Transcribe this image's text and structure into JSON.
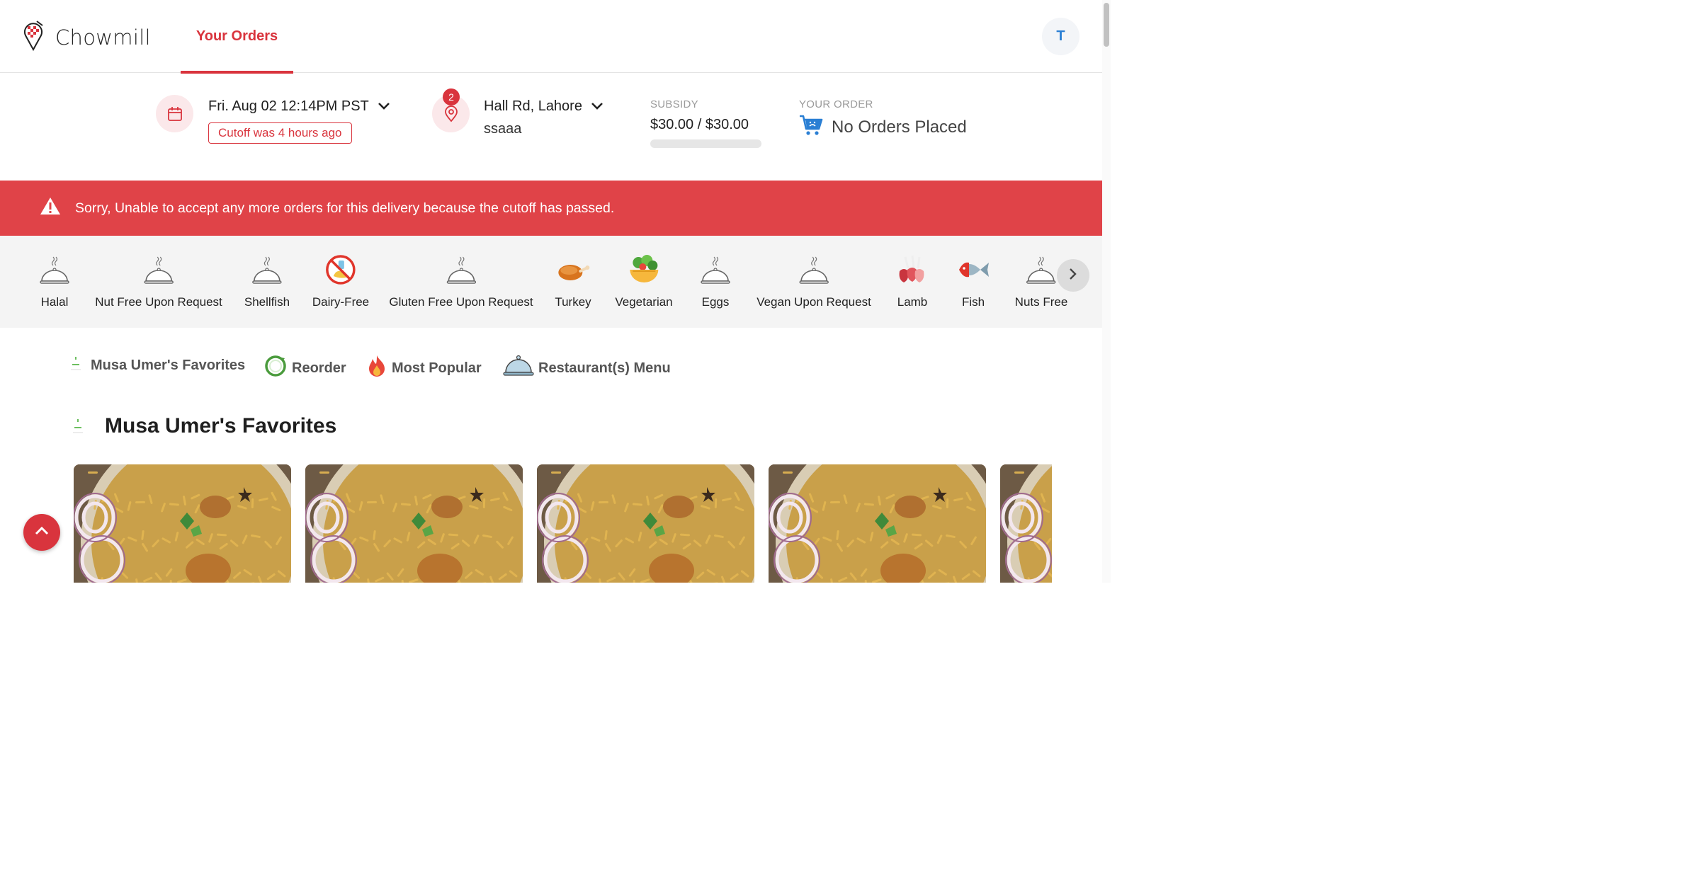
{
  "header": {
    "brand": "Chowmill",
    "nav_tab": "Your Orders",
    "avatar_initial": "T"
  },
  "delivery": {
    "datetime": "Fri. Aug 02 12:14PM PST",
    "cutoff": "Cutoff was 4 hours ago",
    "address_count": "2",
    "address": "Hall Rd, Lahore",
    "address_sub": "ssaaa",
    "subsidy_label": "SUBSIDY",
    "subsidy_value": "$30.00 / $30.00",
    "subsidy_used_fraction": 0,
    "your_order_label": "YOUR ORDER",
    "your_order_value": "No Orders Placed"
  },
  "alert": {
    "message": "Sorry, Unable to accept any more orders for this delivery because the cutoff has passed."
  },
  "filters": [
    {
      "label": "Halal",
      "icon": "cloche-icon"
    },
    {
      "label": "Nut Free Upon Request",
      "icon": "cloche-icon"
    },
    {
      "label": "Shellfish",
      "icon": "cloche-icon"
    },
    {
      "label": "Dairy-Free",
      "icon": "no-dairy-icon"
    },
    {
      "label": "Gluten Free Upon Request",
      "icon": "cloche-icon"
    },
    {
      "label": "Turkey",
      "icon": "turkey-icon"
    },
    {
      "label": "Vegetarian",
      "icon": "salad-bowl-icon"
    },
    {
      "label": "Eggs",
      "icon": "cloche-icon"
    },
    {
      "label": "Vegan Upon Request",
      "icon": "cloche-icon"
    },
    {
      "label": "Lamb",
      "icon": "lamb-chops-icon"
    },
    {
      "label": "Fish",
      "icon": "fish-icon"
    },
    {
      "label": "Nuts Free",
      "icon": "cloche-icon"
    }
  ],
  "categories": [
    {
      "label": "Musa Umer's Favorites",
      "icon": "favorites-icon"
    },
    {
      "label": "Reorder",
      "icon": "reorder-icon"
    },
    {
      "label": "Most Popular",
      "icon": "fire-icon"
    },
    {
      "label": "Restaurant(s) Menu",
      "icon": "cloche-icon"
    }
  ],
  "section": {
    "title": "Musa Umer's Favorites"
  },
  "colors": {
    "accent": "#d9343d",
    "alert_bg": "#e04348",
    "filter_bg": "#f4f4f4",
    "avatar_text": "#2a7fd4"
  }
}
